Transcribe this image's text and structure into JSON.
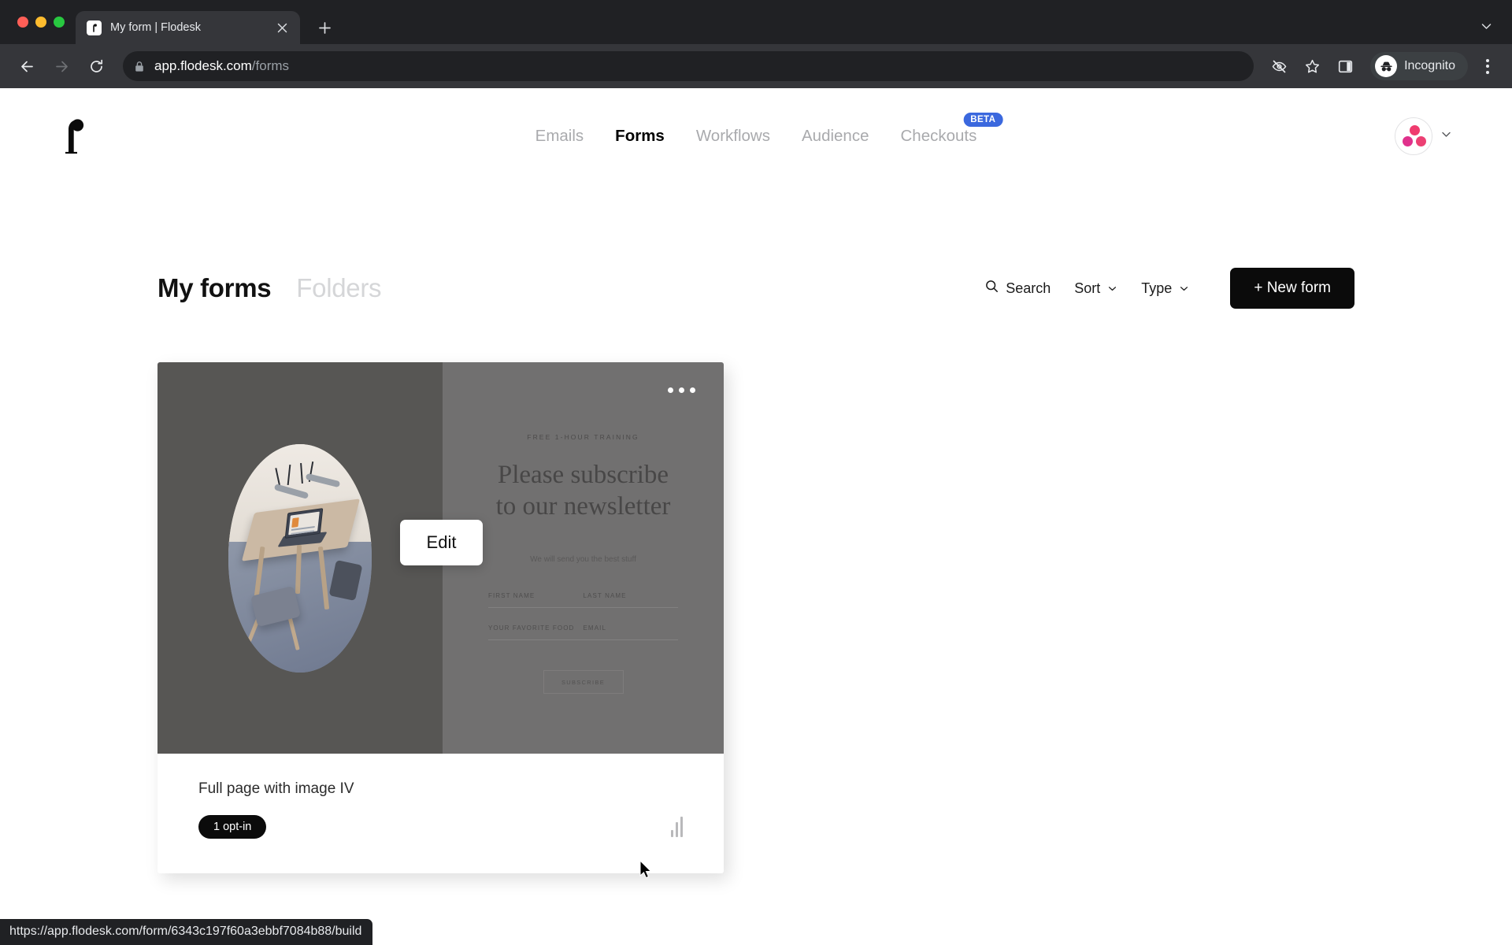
{
  "browser": {
    "tab": {
      "title": "My form | Flodesk",
      "favicon_icon": "flodesk-f-icon",
      "close_icon": "close-icon"
    },
    "new_tab_icon": "plus-icon",
    "tab_list_icon": "chevron-down-icon",
    "back_icon": "arrow-left-icon",
    "forward_icon": "arrow-right-icon",
    "reload_icon": "reload-icon",
    "lock_icon": "lock-icon",
    "url_host": "app.flodesk.com",
    "url_path": "/forms",
    "tracking_icon": "eye-slash-icon",
    "bookmark_icon": "star-icon",
    "sidepanel_icon": "side-panel-icon",
    "incognito_label": "Incognito",
    "incognito_icon": "incognito-hat-glasses-icon",
    "menu_icon": "kebab-menu-icon",
    "status_url": "https://app.flodesk.com/form/6343c197f60a3ebbf7084b88/build"
  },
  "app": {
    "logo_icon": "flodesk-logo-icon",
    "nav": [
      {
        "label": "Emails",
        "active": false
      },
      {
        "label": "Forms",
        "active": true
      },
      {
        "label": "Workflows",
        "active": false
      },
      {
        "label": "Audience",
        "active": false
      },
      {
        "label": "Checkouts",
        "active": false,
        "badge": "BETA"
      }
    ],
    "avatar_icon": "account-avatar-icon",
    "avatar_chevron_icon": "chevron-down-icon"
  },
  "header": {
    "title": "My forms",
    "secondary_tab": "Folders",
    "search_label": "Search",
    "search_icon": "search-icon",
    "sort_label": "Sort",
    "type_label": "Type",
    "chevron_icon": "chevron-down-icon",
    "new_form_label": "+ New form"
  },
  "card": {
    "overflow_icon": "more-horizontal-icon",
    "edit_label": "Edit",
    "title": "Full page with image IV",
    "optin_badge": "1 opt-in",
    "analytics_icon": "bar-chart-icon",
    "preview": {
      "image_icon": "desk-workspace-photo",
      "eyebrow": "FREE 1-HOUR TRAINING",
      "heading_line1": "Please subscribe",
      "heading_line2": "to our newsletter",
      "subtext": "We will send you the best stuff",
      "fields": [
        "FIRST NAME",
        "LAST NAME",
        "YOUR FAVORITE FOOD",
        "EMAIL"
      ],
      "submit_label": "SUBSCRIBE"
    }
  },
  "colors": {
    "accent_black": "#0b0b0b",
    "beta_blue": "#3b68de",
    "avatar_pink": "#ef3b6e",
    "chrome_dark": "#202124",
    "chrome_toolbar": "#35363a"
  }
}
